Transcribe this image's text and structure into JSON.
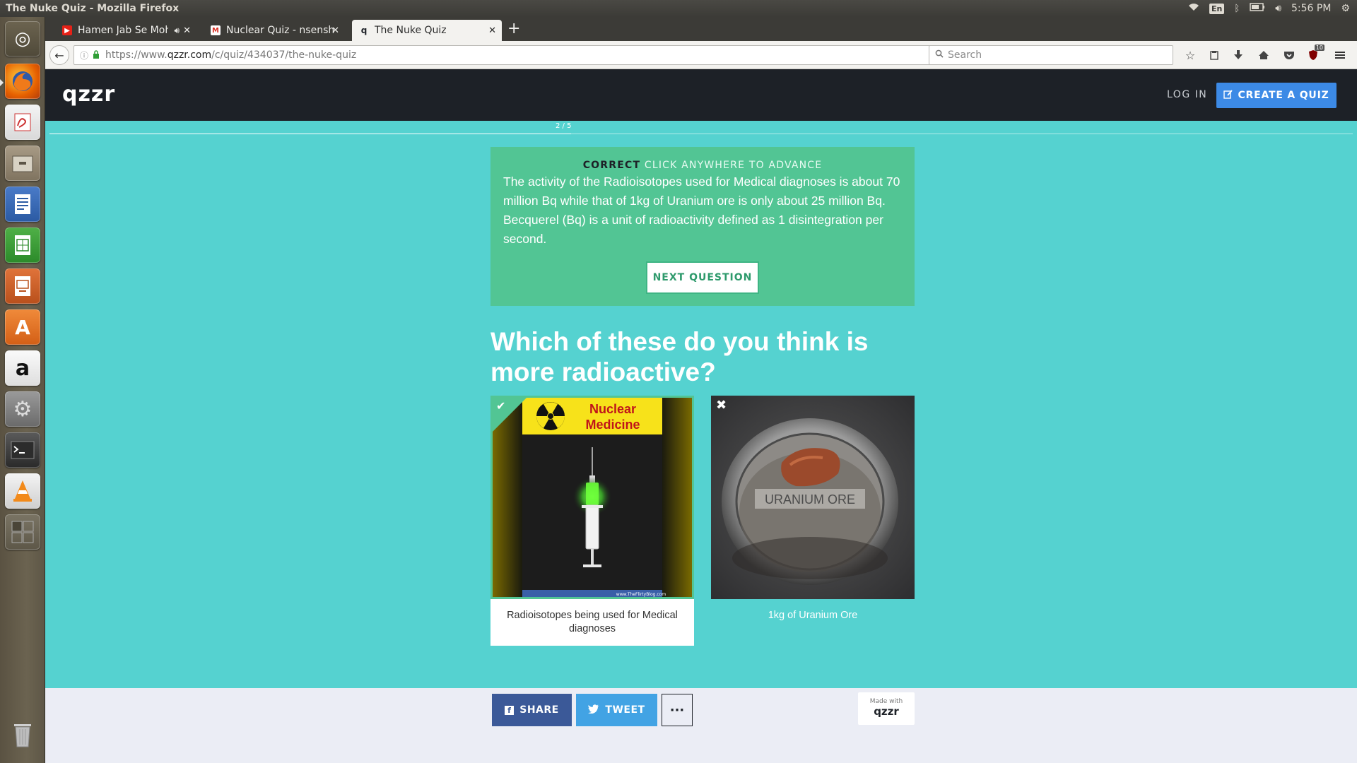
{
  "window": {
    "title": "The Nuke Quiz - Mozilla Firefox",
    "clock": "5:56 PM",
    "keyboard": "En"
  },
  "launcher": {
    "items": [
      "ubuntu-dash",
      "firefox",
      "evince",
      "files",
      "writer",
      "calc",
      "impress",
      "software-center",
      "amazon",
      "system-settings",
      "terminal",
      "vlc",
      "workspaces",
      "trash"
    ]
  },
  "tabs": [
    {
      "label": "Hamen Jab Se Moha",
      "icon": "youtube-icon"
    },
    {
      "label": "Nuclear Quiz - nsensha",
      "icon": "gmail-icon"
    },
    {
      "label": "The Nuke Quiz",
      "icon": "qzzr-icon"
    }
  ],
  "navbar": {
    "url_prefix": "https://www.",
    "url_domain": "qzzr.com",
    "url_path": "/c/quiz/434037/the-nuke-quiz",
    "search_placeholder": "Search",
    "ublock_badge": "10"
  },
  "site": {
    "logo": "qzzr",
    "login": "LOG IN",
    "create": "CREATE A QUIZ"
  },
  "quiz": {
    "progress": "2 / 5",
    "progress_fraction": 0.4,
    "result_label": "CORRECT",
    "advance_hint": "CLICK ANYWHERE TO ADVANCE",
    "explanation": "The activity of the Radioisotopes used for Medical diagnoses is about 70 million Bq while that of 1kg of Uranium ore is only about 25 million Bq. Becquerel (Bq) is a unit of radioactivity defined as 1 disintegration per second.",
    "next_button": "NEXT QUESTION",
    "question": "Which of these do you think is more radioactive?",
    "answers": [
      {
        "caption": "Radioisotopes being used for Medical diagnoses",
        "state": "correct",
        "image_text_1": "Nuclear",
        "image_text_2": "Medicine",
        "image_credit": "www.TheFlirtyBlog.com"
      },
      {
        "caption": "1kg of Uranium Ore",
        "state": "wrong",
        "image_text": "URANIUM ORE"
      }
    ]
  },
  "footer": {
    "share": "SHARE",
    "tweet": "TWEET",
    "more": "···",
    "made_with": "Made with",
    "made_logo": "qzzr"
  },
  "colors": {
    "page_bg": "#55d2d0",
    "correct_green": "#52c594",
    "header_dark": "#1d2127",
    "create_blue": "#3c8ae6",
    "facebook": "#3b5998",
    "twitter": "#42a3e4"
  }
}
